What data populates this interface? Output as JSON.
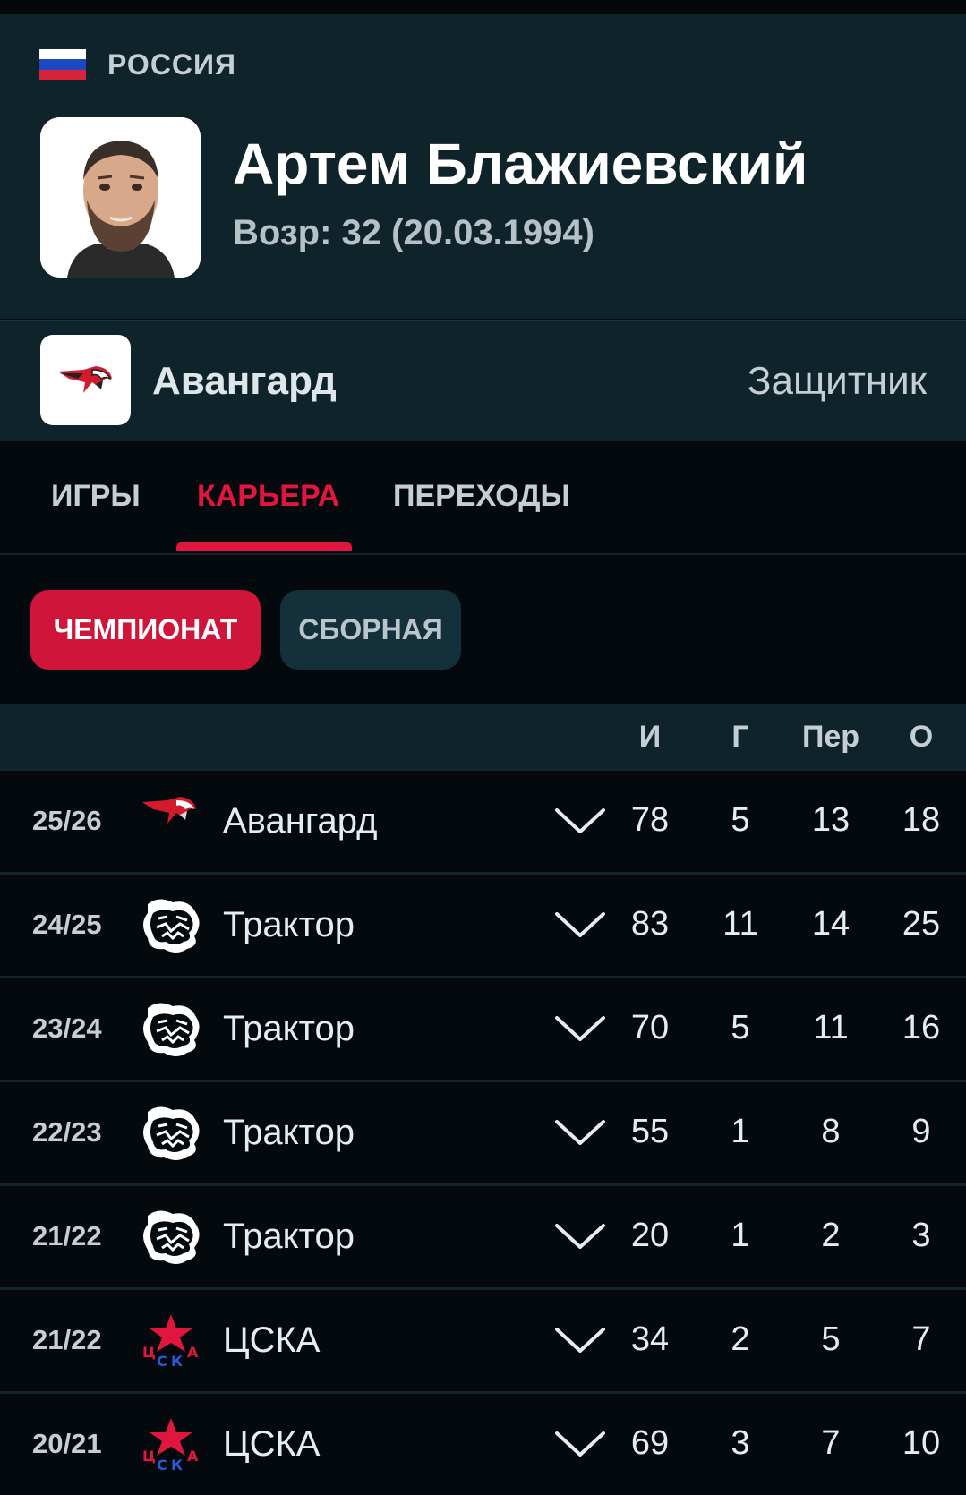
{
  "header": {
    "country": "РОССИЯ",
    "player_name": "Артем Блажиевский",
    "age_label": "Возр: 32 (20.03.1994)"
  },
  "team_bar": {
    "team_name": "Авангард",
    "position": "Защитник",
    "logo_icon": "avangard-hawk-icon"
  },
  "tabs": [
    {
      "label": "ИГРЫ",
      "active": false
    },
    {
      "label": "КАРЬЕРА",
      "active": true
    },
    {
      "label": "ПЕРЕХОДЫ",
      "active": false
    }
  ],
  "filters": [
    {
      "label": "ЧЕМПИОНАТ",
      "active": true
    },
    {
      "label": "СБОРНАЯ",
      "active": false
    }
  ],
  "table": {
    "columns": [
      "И",
      "Г",
      "Пер",
      "О"
    ],
    "rows": [
      {
        "season": "25/26",
        "club": "Авангард",
        "icon": "avangard-hawk-icon",
        "games": "78",
        "goals": "5",
        "assists": "13",
        "points": "18"
      },
      {
        "season": "24/25",
        "club": "Трактор",
        "icon": "traktor-bear-icon",
        "games": "83",
        "goals": "11",
        "assists": "14",
        "points": "25"
      },
      {
        "season": "23/24",
        "club": "Трактор",
        "icon": "traktor-bear-icon",
        "games": "70",
        "goals": "5",
        "assists": "11",
        "points": "16"
      },
      {
        "season": "22/23",
        "club": "Трактор",
        "icon": "traktor-bear-icon",
        "games": "55",
        "goals": "1",
        "assists": "8",
        "points": "9"
      },
      {
        "season": "21/22",
        "club": "Трактор",
        "icon": "traktor-bear-icon",
        "games": "20",
        "goals": "1",
        "assists": "2",
        "points": "3"
      },
      {
        "season": "21/22",
        "club": "ЦСКА",
        "icon": "cska-star-icon",
        "games": "34",
        "goals": "2",
        "assists": "5",
        "points": "7"
      },
      {
        "season": "20/21",
        "club": "ЦСКА",
        "icon": "cska-star-icon",
        "games": "69",
        "goals": "3",
        "assists": "7",
        "points": "10"
      }
    ]
  },
  "colors": {
    "accent": "#e0163e",
    "header_bg": "#0f232b",
    "page_bg": "#03090d"
  }
}
